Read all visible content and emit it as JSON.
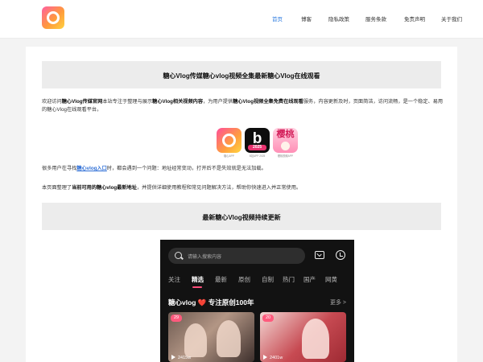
{
  "nav": {
    "items": [
      {
        "label": "首页",
        "active": true
      },
      {
        "label": "博客",
        "active": false
      },
      {
        "label": "隐私政策",
        "active": false
      },
      {
        "label": "服务条款",
        "active": false
      },
      {
        "label": "免责声明",
        "active": false
      },
      {
        "label": "关于我们",
        "active": false
      }
    ]
  },
  "main": {
    "title": "糖心Vlog传媒糖心vlog视频全集最新糖心Vlog在线观看",
    "intro": {
      "p1": "欢迎访问",
      "b1": "糖心Vlog传媒官网",
      "p2": "本站专注于整理与展示",
      "b2": "糖心Vlog相关视频内容",
      "p3": "，为用户提供",
      "b3": "糖心Vlog视频全集免费在线观看",
      "p4": "服务，内容更新及时，页面简洁，访问流畅，是一个稳定、易用的糖心Vlog在线观看平台。"
    },
    "apps": [
      {
        "label": "糖心APP",
        "icon": "tangxin-app-icon"
      },
      {
        "label": "B站APP 2025",
        "text": "b",
        "year": "2025",
        "icon": "b-app-icon"
      },
      {
        "label": "樱桃视频APP",
        "text": "樱桃",
        "icon": "cherry-app-icon"
      }
    ],
    "para2": {
      "p1": "很多用户在寻找",
      "link": "糖心vlog入口",
      "p2": "时，都会遇到一个问题：地址经常变动，打开后不是失效就是无法加载。"
    },
    "para3": {
      "p1": "本页面整理了",
      "b1": "当前可用的糖心vlog最新地址",
      "p2": "，并提供详细使用教程和常见问题解决方法，帮助你快速进入并正常使用。"
    },
    "subtitle": "最新糖心Vlog视频持续更新"
  },
  "phone": {
    "search_placeholder": "请输入搜索内容",
    "tabs": [
      {
        "label": "关注",
        "active": false
      },
      {
        "label": "精选",
        "active": true
      },
      {
        "label": "最新",
        "active": false
      },
      {
        "label": "原创",
        "active": false
      },
      {
        "label": "自制",
        "active": false
      },
      {
        "label": "热门",
        "active": false
      },
      {
        "label": "国产",
        "active": false
      },
      {
        "label": "网黄",
        "active": false
      }
    ],
    "section_title": "糖心vlog ❤️ 专注原创100年",
    "more": "更多 >",
    "videos": [
      {
        "badge": "29",
        "views": "2415w"
      },
      {
        "badge": "20",
        "views": "2401w"
      }
    ]
  }
}
